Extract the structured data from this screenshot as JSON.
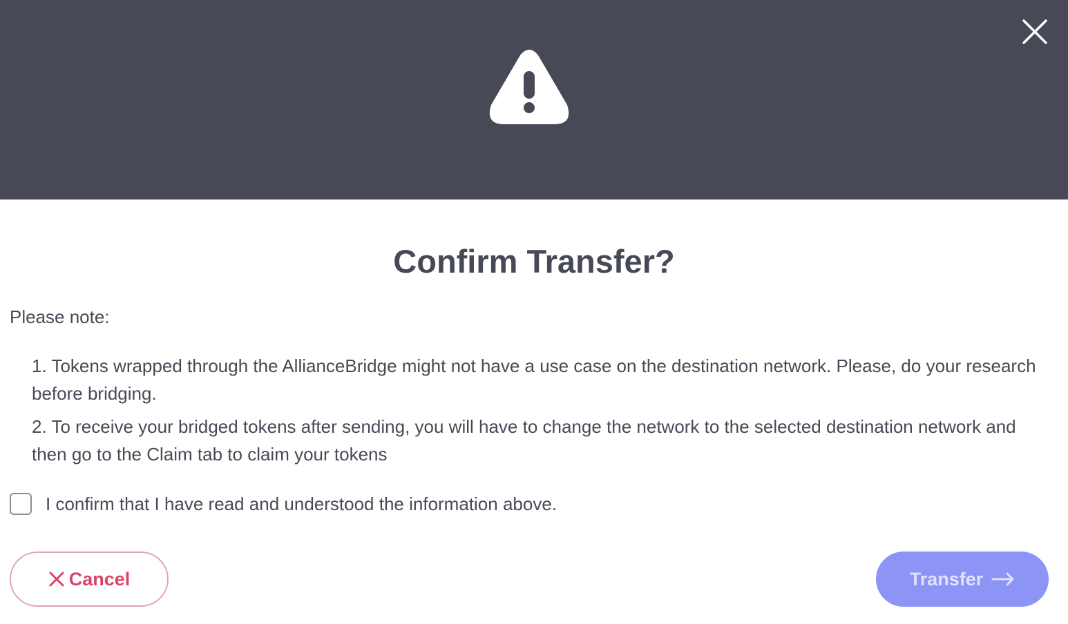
{
  "dialog": {
    "title": "Confirm Transfer?",
    "note_label": "Please note:",
    "notes": [
      "1. Tokens wrapped through the AllianceBridge might not have a use case on the destination network. Please, do your research before bridging.",
      "2. To receive your bridged tokens after sending, you will have to change the network to the selected destination network and then go to the Claim tab to claim your tokens"
    ],
    "confirm_label": "I confirm that I have read and understood the information above.",
    "confirm_checked": false
  },
  "buttons": {
    "cancel_label": "Cancel",
    "transfer_label": "Transfer"
  },
  "icons": {
    "header_icon": "warning-icon",
    "close": "close-icon",
    "cancel": "x-icon",
    "transfer": "arrow-right-icon"
  },
  "colors": {
    "header_bg": "#474a56",
    "text": "#474a56",
    "cancel_accent": "#d8456b",
    "transfer_bg": "#8c94f5"
  }
}
